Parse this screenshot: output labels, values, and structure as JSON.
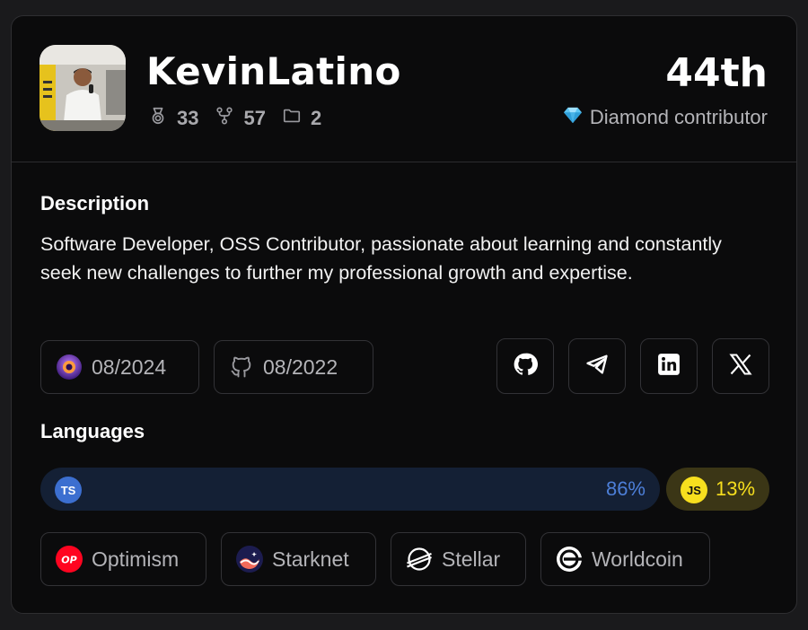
{
  "profile": {
    "username": "KevinLatino",
    "stats": {
      "rewards": "33",
      "contributions": "57",
      "projects": "2"
    },
    "rank": "44th",
    "tier_icon": "diamond-gem",
    "tier": "Diamond contributor"
  },
  "description": {
    "title": "Description",
    "text": "Software Developer, OSS Contributor, passionate about learning and constantly seek new challenges to further my professional growth and expertise."
  },
  "dates": {
    "onlydust_joined": "08/2024",
    "github_joined": "08/2022"
  },
  "socials": [
    "github-icon",
    "telegram-icon",
    "linkedin-icon",
    "x-icon"
  ],
  "languages": {
    "title": "Languages",
    "items": [
      {
        "name": "TypeScript",
        "badge": "TS",
        "percent": "86%",
        "color": "#3c6fd0"
      },
      {
        "name": "JavaScript",
        "badge": "JS",
        "percent": "13%",
        "color": "#f7df1e"
      }
    ]
  },
  "ecosystems": [
    "Optimism",
    "Starknet",
    "Stellar",
    "Worldcoin"
  ],
  "colors": {
    "background": "#0b0b0c",
    "border": "#2e2e31",
    "muted_text": "#b4b4b8",
    "ts_accent": "#4d7fd8",
    "js_accent": "#f7df1e",
    "optimism_red": "#ff0420"
  }
}
